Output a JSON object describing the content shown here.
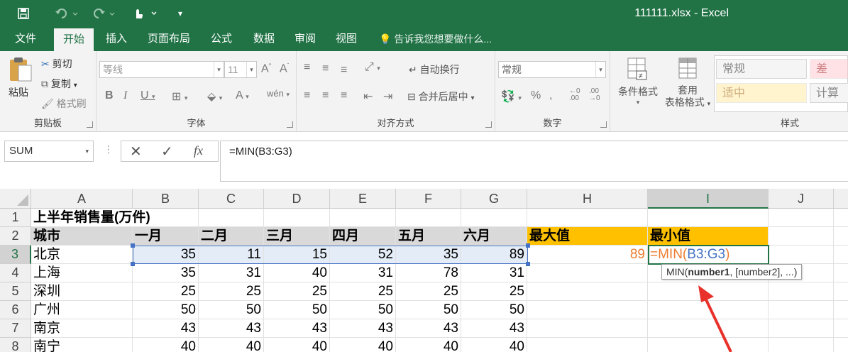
{
  "window": {
    "title": "111111.xlsx - Excel"
  },
  "menu": {
    "tabs": [
      "文件",
      "开始",
      "插入",
      "页面布局",
      "公式",
      "数据",
      "审阅",
      "视图"
    ],
    "tell_me": "告诉我您想要做什么..."
  },
  "ribbon": {
    "clipboard": {
      "paste": "粘贴",
      "cut": "剪切",
      "copy": "复制",
      "format_painter": "格式刷",
      "label": "剪贴板"
    },
    "font": {
      "name": "等线",
      "size": "11",
      "label": "字体"
    },
    "alignment": {
      "wrap": "自动换行",
      "merge": "合并后居中",
      "label": "对齐方式"
    },
    "number": {
      "format": "常规",
      "label": "数字"
    },
    "styles": {
      "conditional": "条件格式",
      "table_line1": "套用",
      "table_line2": "表格格式",
      "cells": [
        "常规",
        "差",
        "适中",
        "计算"
      ],
      "label": "样式"
    }
  },
  "formula_bar": {
    "name_box": "SUM",
    "formula": "=MIN(B3:G3)"
  },
  "grid": {
    "columns": [
      "A",
      "B",
      "C",
      "D",
      "E",
      "F",
      "G",
      "H",
      "I",
      "J"
    ],
    "rows": [
      "1",
      "2",
      "3",
      "4",
      "5",
      "6",
      "7",
      "8"
    ],
    "title": "上半年销售量(万件)",
    "headers": [
      "城市",
      "一月",
      "二月",
      "三月",
      "四月",
      "五月",
      "六月"
    ],
    "h_header": "最大值",
    "i_header": "最小值",
    "data": [
      {
        "city": "北京",
        "values": [
          "35",
          "11",
          "15",
          "52",
          "35",
          "89"
        ]
      },
      {
        "city": "上海",
        "values": [
          "35",
          "31",
          "40",
          "31",
          "78",
          "31"
        ]
      },
      {
        "city": "深圳",
        "values": [
          "25",
          "25",
          "25",
          "25",
          "25",
          "25"
        ]
      },
      {
        "city": "广州",
        "values": [
          "50",
          "50",
          "50",
          "50",
          "50",
          "50"
        ]
      },
      {
        "city": "南京",
        "values": [
          "43",
          "43",
          "43",
          "43",
          "43",
          "43"
        ]
      },
      {
        "city": "南宁",
        "values": [
          "40",
          "40",
          "40",
          "40",
          "40",
          "40"
        ]
      }
    ],
    "h3_value": "89",
    "i3_edit": {
      "prefix": "=MIN(",
      "ref_start": "B3",
      "colon": ":",
      "ref_end": "G3",
      "suffix": ")"
    },
    "tooltip": {
      "fn": "MIN(",
      "arg1": "number1",
      "rest": ", [number2], ...)"
    }
  },
  "colors": {
    "excel_green": "#217346",
    "gold": "#ffc000",
    "header_gray": "#d9d9d9",
    "formula_orange": "#ed7d31",
    "ref_blue": "#4472c4",
    "arrow_red": "#e8312a"
  }
}
